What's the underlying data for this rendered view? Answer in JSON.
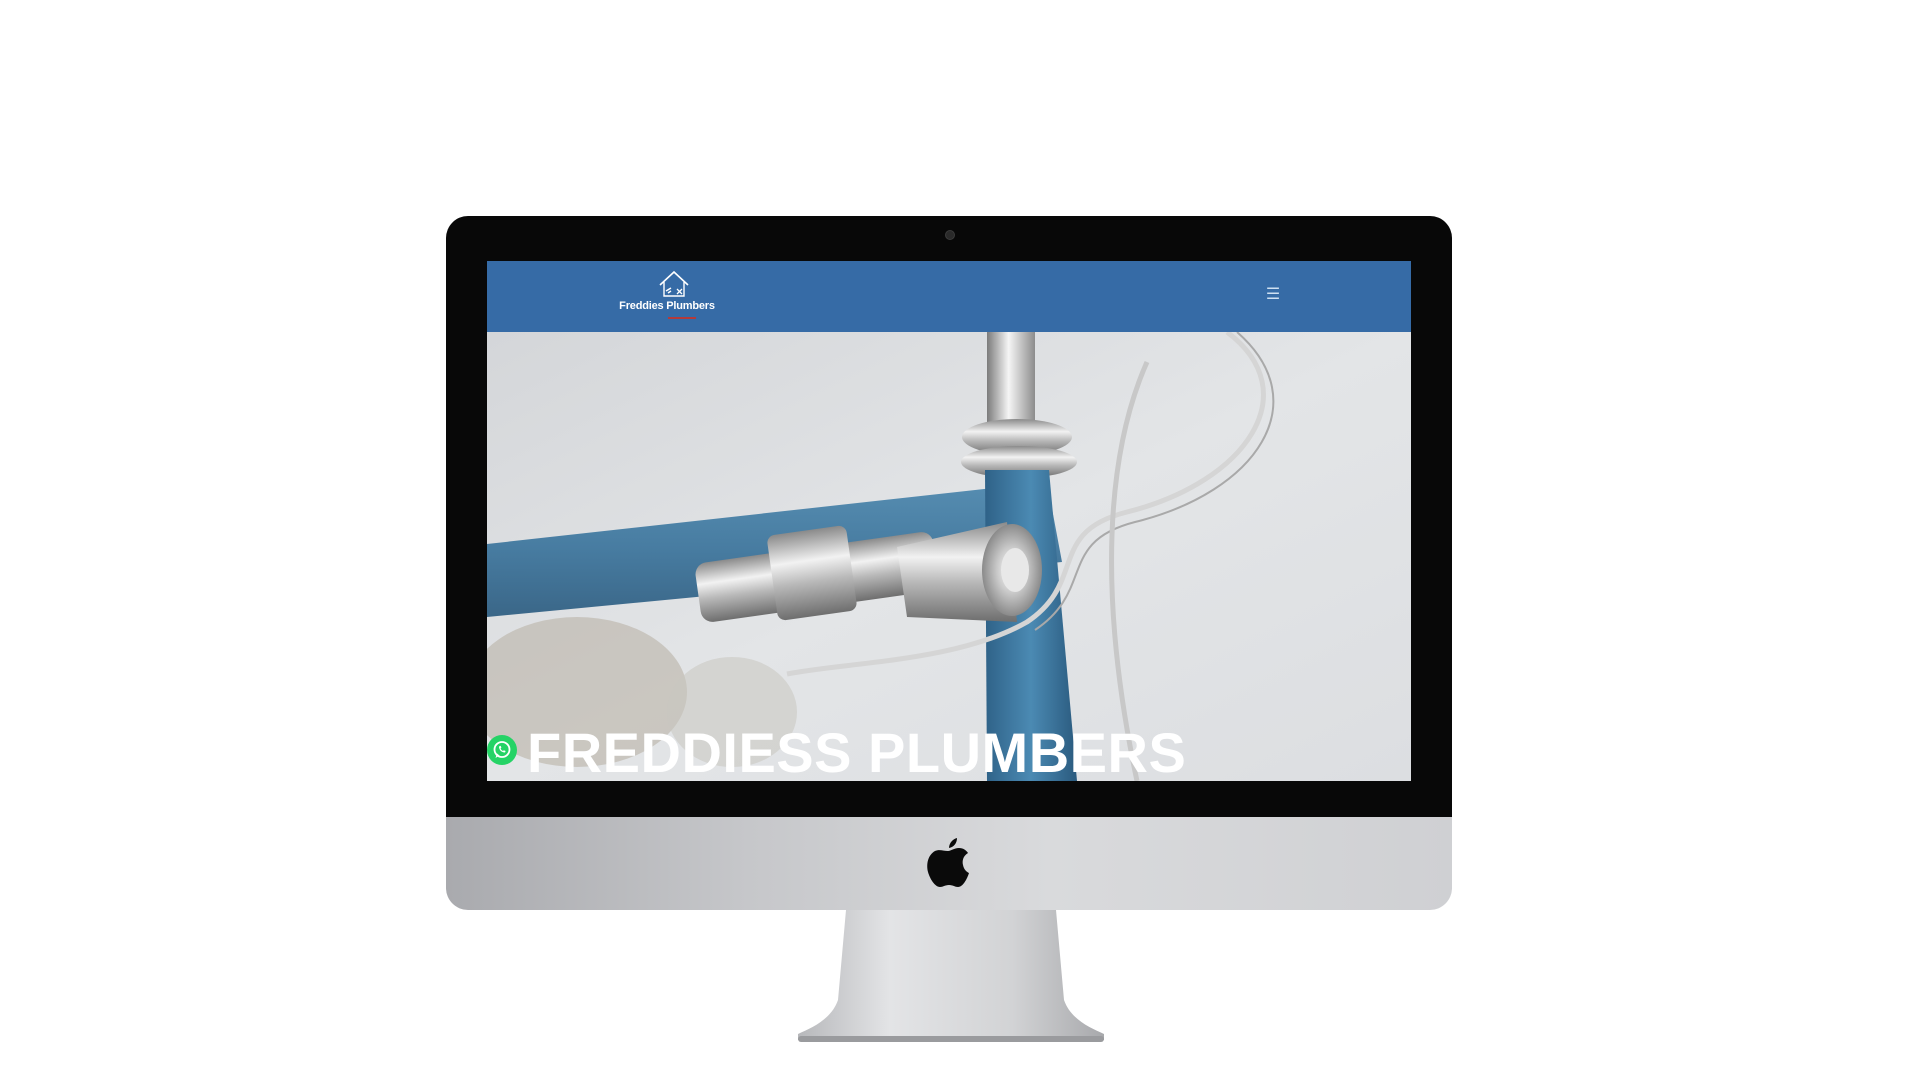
{
  "site": {
    "brand_name": "Freddies Plumbers",
    "hero_title": "FREDDIESS PLUMBERS",
    "menu_icon": "☰"
  },
  "icons": {
    "logo": "house-wrench-icon",
    "menu": "hamburger-menu-icon",
    "whatsapp": "whatsapp-icon",
    "device_logo": "apple-logo-icon"
  },
  "colors": {
    "header": "#366ba6",
    "whatsapp": "#25d366",
    "accent_underline": "#b43a3a",
    "bezel": "#080808"
  }
}
